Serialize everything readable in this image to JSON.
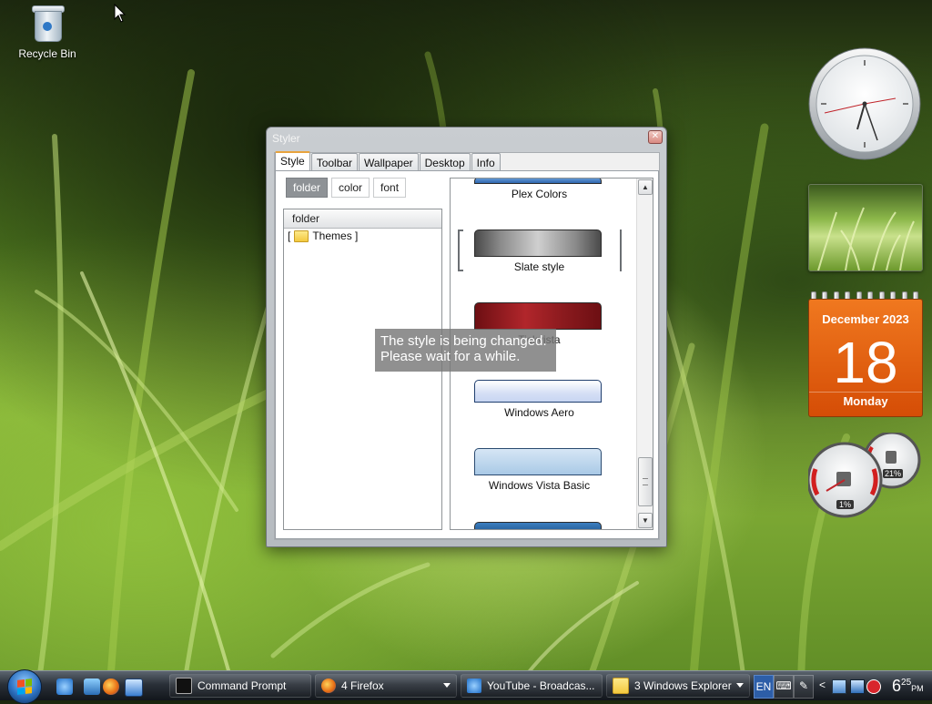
{
  "desktop": {
    "icons": [
      {
        "label": "Recycle Bin",
        "icon": "recycle-bin-icon"
      }
    ]
  },
  "window": {
    "title": "Styler",
    "close_glyph": "✕",
    "tabs": [
      "Style",
      "Toolbar",
      "Wallpaper",
      "Desktop",
      "Info"
    ],
    "active_tab": "Style",
    "subtabs": [
      "folder",
      "color",
      "font"
    ],
    "active_subtab": "folder",
    "tree": {
      "header": "folder",
      "items": [
        {
          "label": "Themes",
          "icon": "folder-icon"
        }
      ]
    },
    "style_list": {
      "items": [
        {
          "name": "Plex Colors",
          "color": "#3a6fb3"
        },
        {
          "name": "Slate style",
          "color": "#5a5a5a",
          "selected": true
        },
        {
          "name": "Tickvista",
          "color": "#8b1a1e"
        },
        {
          "name": "Windows Aero",
          "color": "#d9e2f5"
        },
        {
          "name": "Windows Vista Basic",
          "color": "#a9c9e6"
        },
        {
          "name": "",
          "color": "#2d6aa6"
        }
      ]
    },
    "overlay_message": {
      "line1": "The style is being changed.",
      "line2": "Please wait for a while."
    }
  },
  "gadgets": {
    "calendar": {
      "month_year": "December 2023",
      "day": "18",
      "weekday": "Monday"
    },
    "cpu_meter": {
      "cpu": "1%",
      "memory": "21%"
    }
  },
  "taskbar": {
    "quick_launch": [
      "internet-explorer-icon",
      "show-desktop-icon",
      "firefox-icon",
      "switch-windows-icon"
    ],
    "buttons": [
      {
        "label": "Command Prompt",
        "icon": "command-prompt-icon"
      },
      {
        "label": "4 Firefox",
        "icon": "firefox-icon",
        "grouped": true
      },
      {
        "label": "YouTube - Broadcas...",
        "icon": "internet-explorer-icon"
      },
      {
        "label": "3 Windows Explorer",
        "icon": "folder-icon",
        "grouped": true
      }
    ],
    "language": "EN",
    "tray_arrow": "<",
    "clock": {
      "hour": "6",
      "minute": "25",
      "ampm": "PM"
    }
  }
}
